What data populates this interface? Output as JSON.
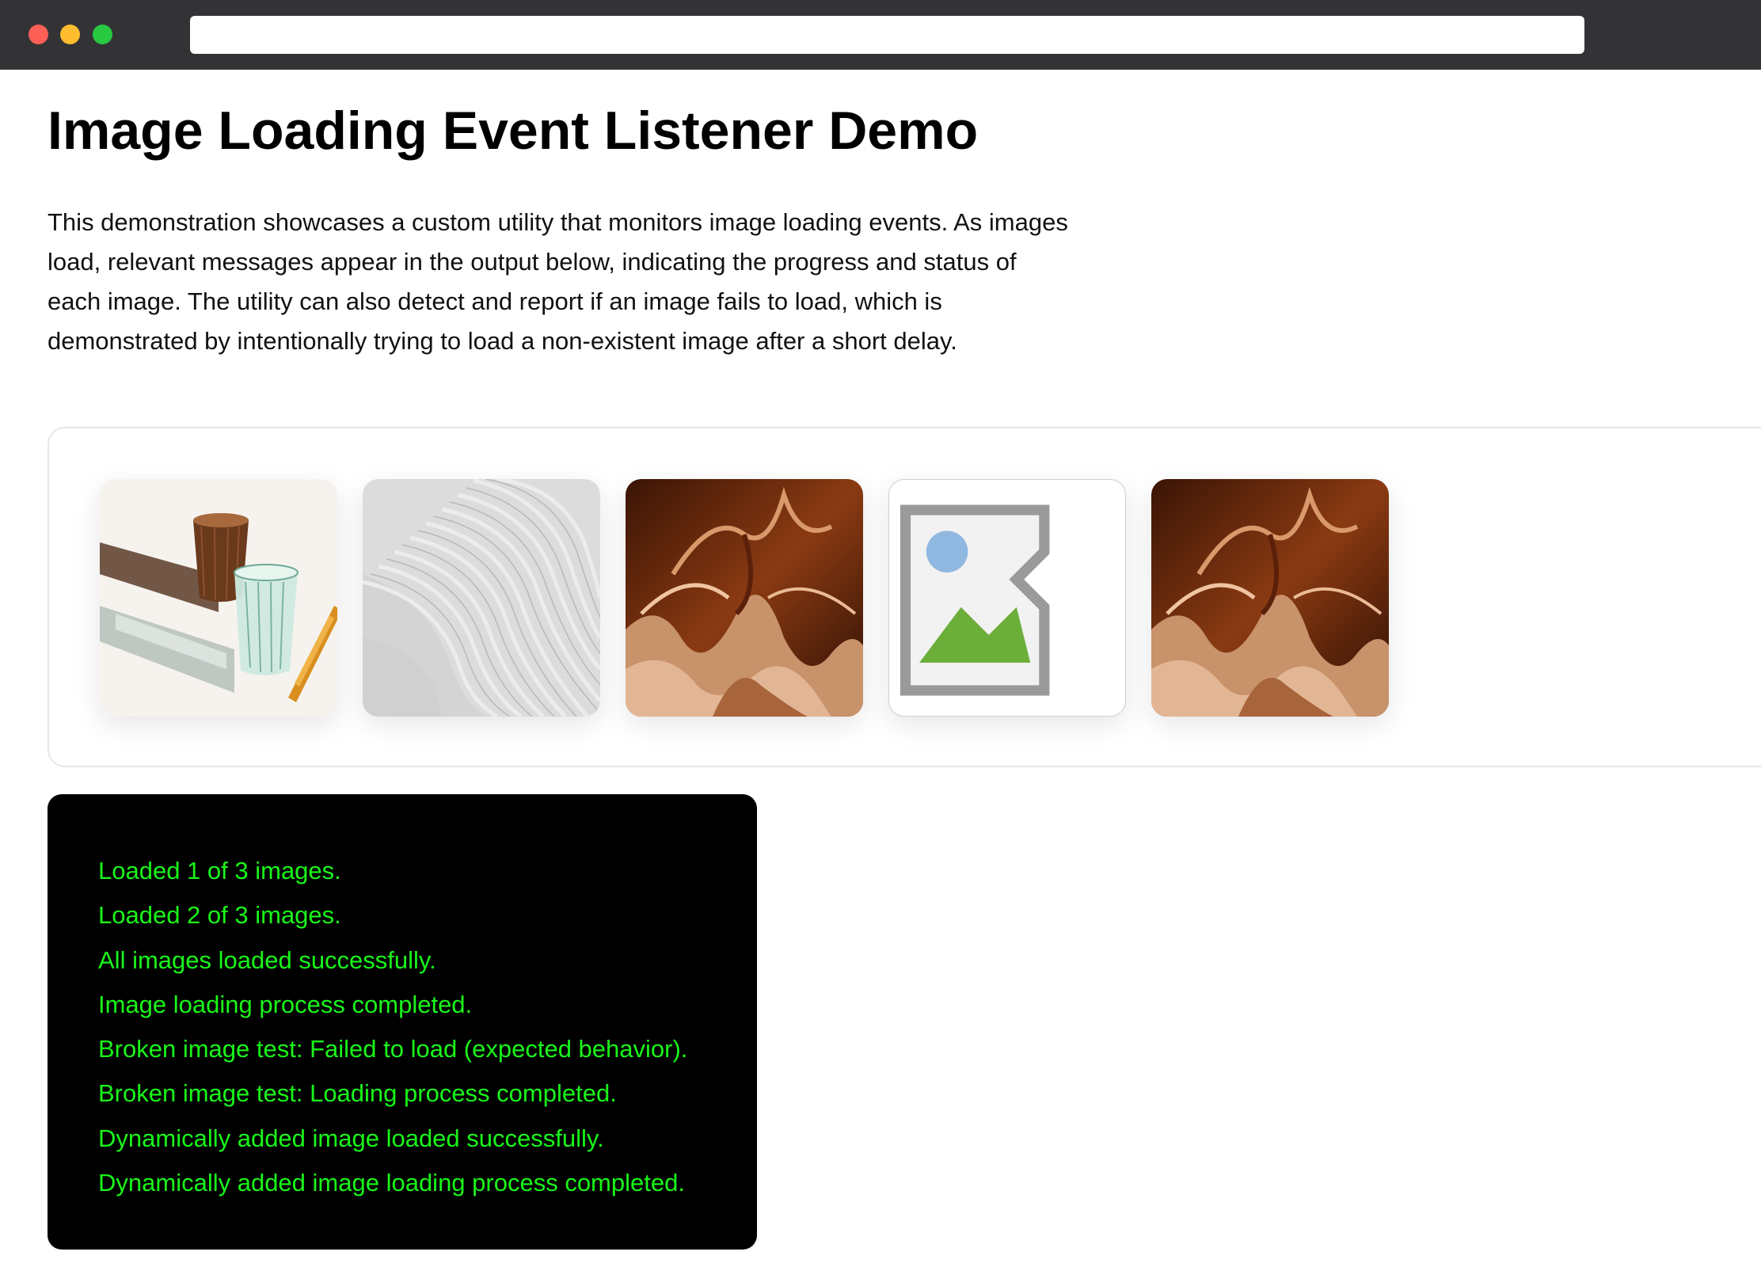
{
  "browser": {
    "url": ""
  },
  "page": {
    "title": "Image Loading Event Listener Demo",
    "description": "This demonstration showcases a custom utility that monitors image loading events. As images load, relevant messages appear in the output below, indicating the progress and status of each image. The utility can also detect and report if an image fails to load, which is demonstrated by intentionally trying to load a non-existent image after a short delay."
  },
  "gallery": {
    "images": [
      {
        "subject": "amber and green ribbed glasses with shadows",
        "status": "loaded"
      },
      {
        "subject": "white wavy layered architectural surface",
        "status": "loaded"
      },
      {
        "subject": "brown silk fabric folds",
        "status": "loaded"
      },
      {
        "subject": "broken-image-icon",
        "status": "failed"
      },
      {
        "subject": "brown silk fabric folds",
        "status": "loaded"
      }
    ]
  },
  "console": {
    "lines": [
      "Loaded 1 of 3 images.",
      "Loaded 2 of 3 images.",
      "All images loaded successfully.",
      "Image loading process completed.",
      "Broken image test: Failed to load (expected behavior).",
      "Broken image test: Loading process completed.",
      "Dynamically added image loaded successfully.",
      "Dynamically added image loading process completed."
    ],
    "text_color": "#19f719",
    "background": "#000000"
  }
}
